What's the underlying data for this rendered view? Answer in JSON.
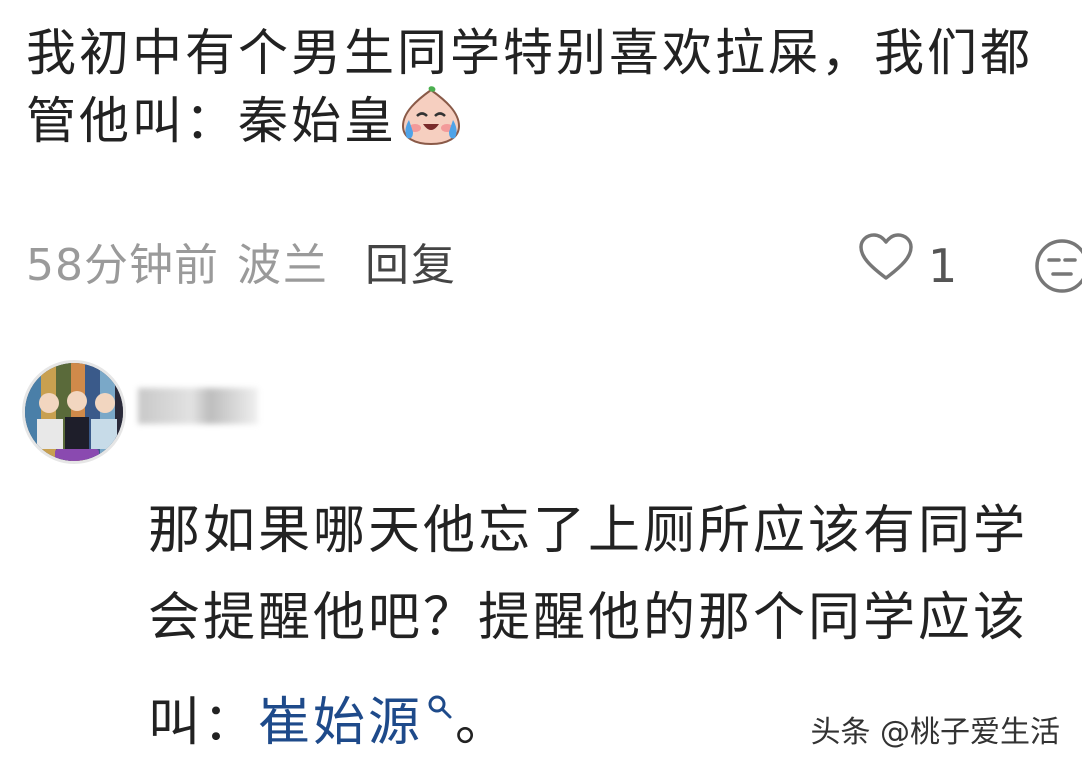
{
  "comment": {
    "text": "我初中有个男生同学特别喜欢拉屎，我们都管他叫：秦始皇",
    "emoji": "laugh-cry-peach-emoji"
  },
  "meta": {
    "time": "58分钟前",
    "location": "波兰",
    "reply_label": "回复",
    "like_count": "1"
  },
  "reply": {
    "text_before": "那如果哪天他忘了上厕所应该有同学会提醒他吧？提醒他的那个同学应该叫：",
    "link_text": "崔始源",
    "text_after": "。"
  },
  "watermark": "头条 @桃子爱生活",
  "colors": {
    "text": "#222222",
    "meta": "#9a9a9a",
    "link": "#1e4a8a"
  }
}
